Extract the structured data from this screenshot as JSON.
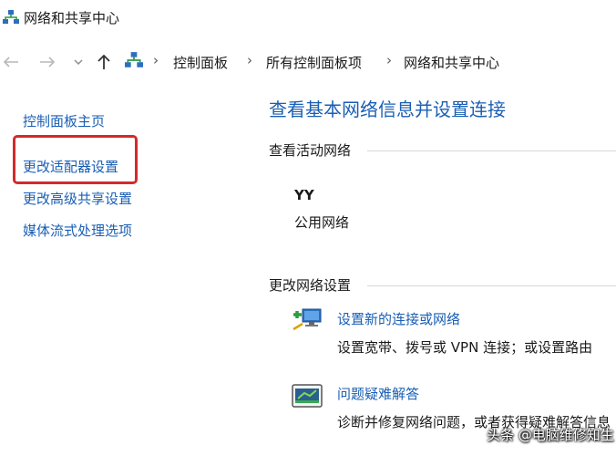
{
  "window": {
    "title": "网络和共享中心"
  },
  "address_bar": {
    "breadcrumbs": [
      "控制面板",
      "所有控制面板项",
      "网络和共享中心"
    ]
  },
  "sidebar": {
    "items": [
      "控制面板主页",
      "更改适配器设置",
      "更改高级共享设置",
      "媒体流式处理选项"
    ],
    "highlighted_item": "更改适配器设置",
    "highlight_color": "#d42a2a"
  },
  "main": {
    "title": "查看基本网络信息并设置连接",
    "active_networks": {
      "header": "查看活动网络",
      "network_name": "YY",
      "network_type": "公用网络"
    },
    "change_settings": {
      "header": "更改网络设置",
      "tasks": [
        {
          "icon": "network-setup-icon",
          "label": "设置新的连接或网络",
          "description": "设置宽带、拨号或 VPN 连接；或设置路由"
        },
        {
          "icon": "troubleshoot-icon",
          "label": "问题疑难解答",
          "description": "诊断并修复网络问题，或者获得疑难解答信息"
        }
      ]
    }
  },
  "watermark": "头条 @电脑维修知生",
  "colors": {
    "link": "#1a5fb4",
    "text": "#1a1a1a",
    "rule": "#d4d8de"
  }
}
